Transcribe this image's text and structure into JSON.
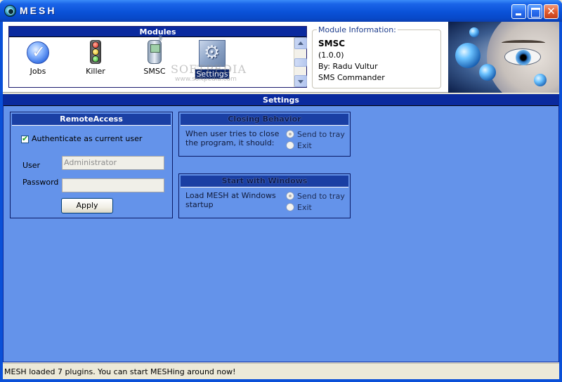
{
  "window": {
    "title": "MESH",
    "icon": "mesh-eye-icon",
    "controls": [
      "minimize-icon",
      "maximize-icon",
      "close-icon"
    ]
  },
  "modules": {
    "header": "Modules",
    "items": [
      {
        "label": "Jobs",
        "icon": "checkmark-icon"
      },
      {
        "label": "Killer",
        "icon": "traffic-light-icon"
      },
      {
        "label": "SMSC",
        "icon": "mobile-phone-icon"
      },
      {
        "label": "Settings",
        "icon": "settings-icon",
        "selected": true
      }
    ],
    "watermark": "SOFTPEDIA",
    "watermark_sub": "www.softpedia.com"
  },
  "module_info": {
    "legend": "Module Information:",
    "name": "SMSC",
    "version": "(1.0.0)",
    "author": "By: Radu Vultur",
    "description": "SMS Commander"
  },
  "settings": {
    "header": "Settings",
    "remote_access": {
      "title": "RemoteAccess",
      "auth_label": "Authenticate as current user",
      "auth_checked": true,
      "user_label": "User",
      "user_value": "Administrator",
      "password_label": "Password",
      "password_value": "",
      "apply_label": "Apply"
    },
    "closing": {
      "title": "Closing Behavior",
      "description": "When user tries to close the program, it should:",
      "options": [
        "Send to tray",
        "Exit"
      ],
      "selected": 0
    },
    "startup": {
      "title": "Start with Windows",
      "description": "Load MESH at Windows startup",
      "options": [
        "Send to tray",
        "Exit"
      ],
      "selected": 0
    }
  },
  "status": "MESH loaded 7 plugins. You can start MESHing around now!",
  "colors": {
    "titlebar": "#0a52d8",
    "panel_bg": "#6493ea",
    "header_bg": "#0a2a9e",
    "selected_bg": "#0a246a"
  }
}
